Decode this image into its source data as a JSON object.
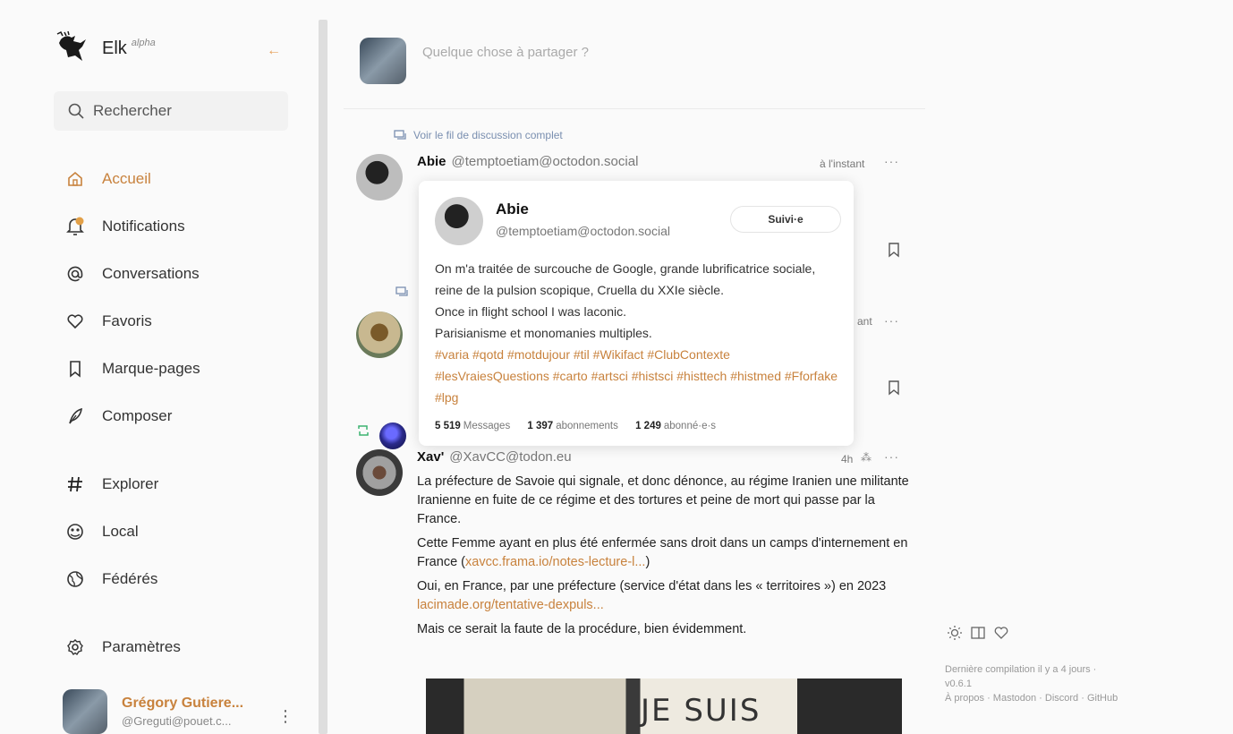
{
  "sidebar": {
    "app_name": "Elk",
    "app_badge": "alpha",
    "collapse_icon": "arrow-left-icon",
    "search": {
      "placeholder": "Rechercher"
    },
    "nav": [
      {
        "label": "Accueil",
        "icon": "home-icon",
        "active": true
      },
      {
        "label": "Notifications",
        "icon": "bell-icon"
      },
      {
        "label": "Conversations",
        "icon": "at-icon"
      },
      {
        "label": "Favoris",
        "icon": "heart-icon"
      },
      {
        "label": "Marque-pages",
        "icon": "bookmark-icon"
      },
      {
        "label": "Composer",
        "icon": "feather-icon"
      },
      {
        "label": "Explorer",
        "icon": "hashtag-icon"
      },
      {
        "label": "Local",
        "icon": "local-icon"
      },
      {
        "label": "Fédérés",
        "icon": "globe-icon"
      },
      {
        "label": "Paramètres",
        "icon": "gear-icon"
      }
    ],
    "user": {
      "name": "Grégory Gutiere...",
      "handle": "@Greguti@pouet.c..."
    }
  },
  "compose": {
    "placeholder": "Quelque chose à partager ?"
  },
  "timeline": {
    "thread_link_label": "Voir le fil de discussion complet",
    "post1": {
      "name": "Abie",
      "handle": "@temptoetiam@octodon.social",
      "time": "à l'instant"
    },
    "post2": {
      "time_partial": "ant"
    },
    "post3": {
      "name": "Xav'",
      "handle": "@XavCC@todon.eu",
      "time": "4h",
      "paragraphs": [
        "La préfecture de Savoie qui signale, et donc dénonce, au régime Iranien une militante Iranienne en fuite de ce régime et des tortures et peine de mort qui passe par la France.",
        "Cette Femme ayant en plus été enfermée sans droit dans un camps d'internement en France (",
        "xavcc.frama.io/notes-lecture-l...",
        ")",
        "Oui, en France, par une préfecture (service d'état dans les « territoires ») en 2023",
        "lacimade.org/tentative-dexpuls...",
        "Mais ce serait la faute de la procédure, bien évidemment."
      ],
      "image_text": "JE SUIS"
    }
  },
  "hovercard": {
    "name": "Abie",
    "handle": "@temptoetiam@octodon.social",
    "follow_label": "Suivi·e",
    "bio_lines": [
      "On m'a traitée de surcouche de Google, grande lubrificatrice sociale, reine de la pulsion scopique, Cruella du XXIe siècle.",
      "Once in flight school I was laconic.",
      "Parisianisme et monomanies multiples."
    ],
    "tags": "#varia #qotd #motdujour #til #Wikifact #ClubContexte #lesVraiesQuestions #carto #artsci #histsci #histtech #histmed #Fforfake #lpg",
    "stats": [
      {
        "value": "5 519",
        "label": "Messages"
      },
      {
        "value": "1 397",
        "label": "abonnements"
      },
      {
        "value": "1 249",
        "label": "abonné·e·s"
      }
    ]
  },
  "right": {
    "footer_line1": "Dernière compilation il y a 4 jours ·",
    "footer_line2": "v0.6.1",
    "footer_links": "À propos · Mastodon · Discord · GitHub"
  },
  "colors": {
    "accent": "#c8823d",
    "link": "#7a8fb0"
  }
}
